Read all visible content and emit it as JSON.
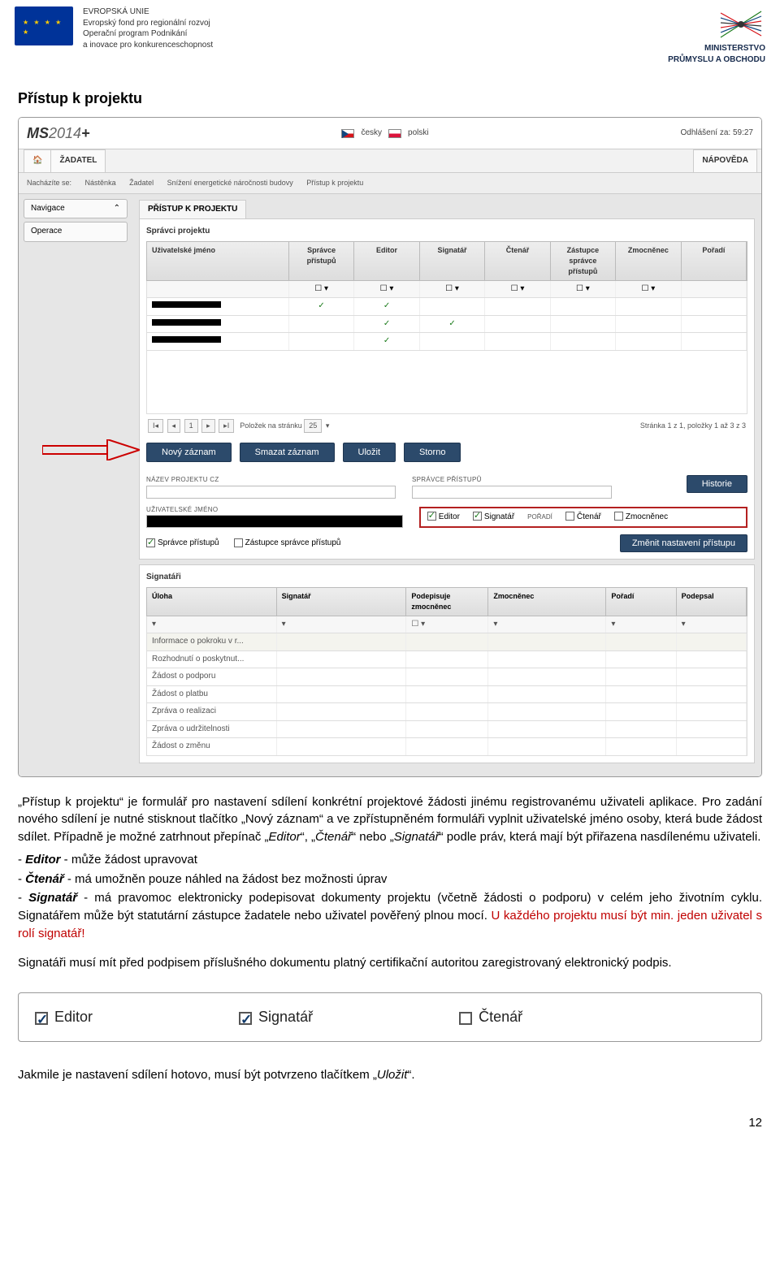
{
  "header": {
    "eu_line1": "EVROPSKÁ UNIE",
    "eu_line2": "Evropský fond pro regionální rozvoj",
    "eu_line3": "Operační program Podnikání",
    "eu_line4": "a inovace pro konkurenceschopnost",
    "ministry_line1": "MINISTERSTVO",
    "ministry_line2": "PRŮMYSLU A OBCHODU"
  },
  "title": "Přístup k projektu",
  "app": {
    "logo": "MS2014+",
    "lang_cz": "česky",
    "lang_pl": "polski",
    "logout": "Odhlášení za: 59:27",
    "tab_zadatel": "ŽADATEL",
    "tab_napoveda": "NÁPOVĚDA",
    "bc_label": "Nacházíte se:",
    "bc_items": [
      "Nástěnka",
      "Žadatel",
      "Snížení energetické náročnosti budovy",
      "Přístup k projektu"
    ],
    "side_nav": "Navigace",
    "side_ops": "Operace",
    "panel_tab": "PŘÍSTUP K PROJEKTU",
    "section_spravci": "Správci projektu",
    "cols": {
      "user": "Uživatelské jméno",
      "spravce": "Správce přístupů",
      "editor": "Editor",
      "signatar": "Signatář",
      "ctenar": "Čtenář",
      "zastupce": "Zástupce správce přístupů",
      "zmocnenec": "Zmocněnec",
      "poradi": "Pořadí"
    },
    "pager_prefix": "Položek na stránku",
    "pager_size": "25",
    "pager_right": "Stránka 1 z 1, položky 1 až 3 z 3",
    "btn_new": "Nový záznam",
    "btn_delete": "Smazat záznam",
    "btn_save": "Uložit",
    "btn_cancel": "Storno",
    "lbl_nazev": "NÁZEV PROJEKTU CZ",
    "lbl_spravce_pristupu": "SPRÁVCE PŘÍSTUPŮ",
    "lbl_uzivatel": "UŽIVATELSKÉ JMÉNO",
    "lbl_poradi": "POŘADÍ",
    "btn_history": "Historie",
    "role_editor": "Editor",
    "role_signatar": "Signatář",
    "role_ctenar": "Čtenář",
    "role_zmocnenec": "Zmocněnec",
    "role_spravce": "Správce přístupů",
    "role_zastupce": "Zástupce správce přístupů",
    "btn_change": "Změnit nastavení přístupu",
    "section_signatari": "Signatáři",
    "scols": {
      "uloha": "Úloha",
      "signatar": "Signatář",
      "podepisuje": "Podepisuje zmocněnec",
      "zmocnenec": "Zmocněnec",
      "poradi": "Pořadí",
      "podepsal": "Podepsal"
    },
    "srows": [
      "Informace o pokroku v r...",
      "Rozhodnutí o poskytnut...",
      "Žádost o podporu",
      "Žádost o platbu",
      "Zpráva o realizaci",
      "Zpráva o udržitelnosti",
      "Žádost o změnu"
    ]
  },
  "p1": "„Přístup k projektu“ je formulář pro nastavení sdílení konkrétní projektové žádosti jinému registrovanému uživateli aplikace. Pro zadání nového sdílení je nutné stisknout tlačítko „Nový záznam“ a ve zpřístupněném formuláři vyplnit uživatelské jméno osoby, která bude žádost sdílet. Případně je možné zatrhnout přepínač „",
  "p1_i1": "Editor",
  "p1_m1": "“, „",
  "p1_i2": "Čtenář",
  "p1_m2": "“ nebo „",
  "p1_i3": "Signatář",
  "p1_m3": "“ podle práv, která mají být přiřazena nasdílenému uživateli.",
  "l1_a": "- ",
  "l1_b": "Editor",
  "l1_c": " - může žádost upravovat",
  "l2_a": "- ",
  "l2_b": "Čtenář",
  "l2_c": " - má umožněn pouze náhled na žádost bez možnosti úprav",
  "l3_a": "- ",
  "l3_b": "Signatář",
  "l3_c": " - má pravomoc elektronicky podepisovat dokumenty projektu (včetně žádosti o podporu) v celém jeho životním cyklu. Signatářem může být statutární zástupce žadatele nebo uživatel pověřený plnou mocí. ",
  "l3_red": "U každého projektu musí být min. jeden uživatel s rolí signatář!",
  "p2": "Signatáři musí mít před podpisem příslušného dokumentu platný certifikační autoritou zaregistrovaný elektronický podpis.",
  "snippet": {
    "editor": "Editor",
    "signatar": "Signatář",
    "ctenar": "Čtenář"
  },
  "p3_a": "Jakmile je nastavení sdílení hotovo, musí být potvrzeno tlačítkem „",
  "p3_b": "Uložit",
  "p3_c": "“.",
  "page_number": "12"
}
